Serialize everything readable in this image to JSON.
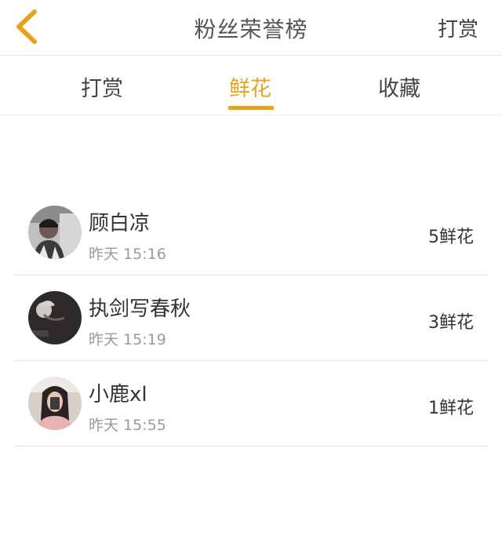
{
  "header": {
    "title": "粉丝荣誉榜",
    "action_label": "打赏",
    "back_icon_color": "#e8a21d"
  },
  "tabs": [
    {
      "label": "打赏",
      "active": false
    },
    {
      "label": "鲜花",
      "active": true
    },
    {
      "label": "收藏",
      "active": false
    }
  ],
  "accent_color": "#e8a21d",
  "list": [
    {
      "name": "顾白凉",
      "time": "昨天 15:16",
      "gift": "5鲜花",
      "avatar": "avatar-photo-1"
    },
    {
      "name": "执剑写春秋",
      "time": "昨天 15:19",
      "gift": "3鲜花",
      "avatar": "avatar-photo-2"
    },
    {
      "name": "小鹿xl",
      "time": "昨天 15:55",
      "gift": "1鲜花",
      "avatar": "avatar-photo-3"
    }
  ]
}
